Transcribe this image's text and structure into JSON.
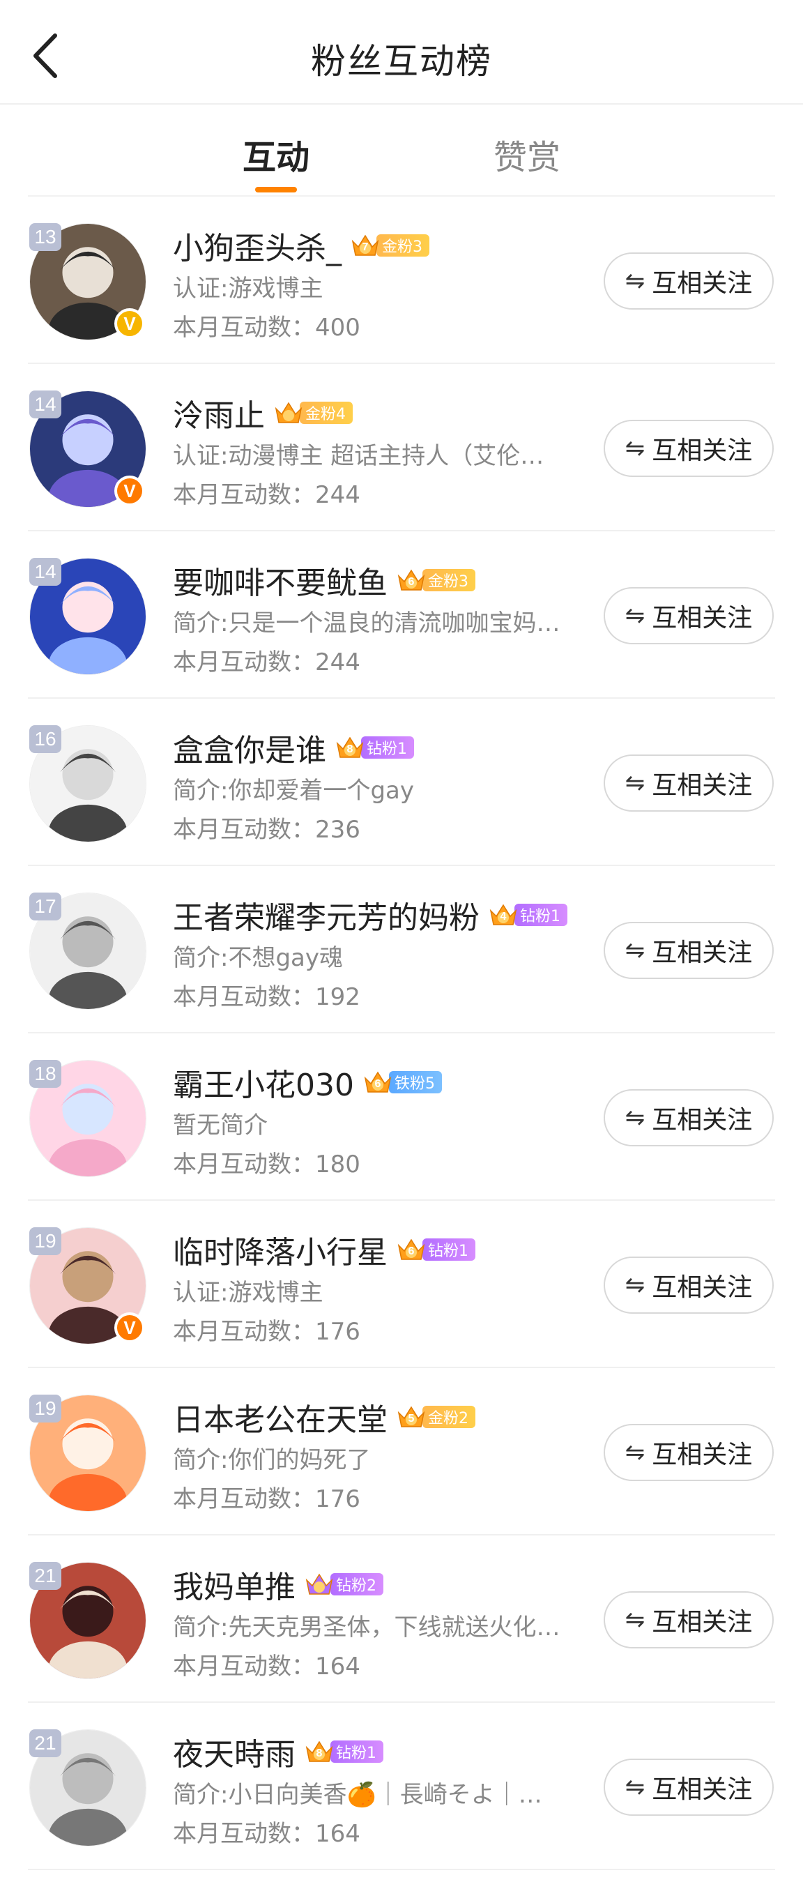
{
  "header": {
    "title": "粉丝互动榜"
  },
  "tabs": [
    {
      "label": "互动",
      "active": true
    },
    {
      "label": "赞赏",
      "active": false
    }
  ],
  "accent_color": "#ff8200",
  "follow_button": {
    "label": "互相关注",
    "icon": "mutual-follow-icon"
  },
  "fans": [
    {
      "rank": "13",
      "name": "小狗歪头杀_",
      "crown_level": "7",
      "badge": "金粉3",
      "badge_type": "gold",
      "desc": "认证:游戏博主",
      "count": "本月互动数：400",
      "verified": "gold"
    },
    {
      "rank": "14",
      "name": "泠雨止",
      "crown_level": "",
      "badge": "金粉4",
      "badge_type": "gold",
      "desc": "认证:动漫博主 超话主持人（艾伦…",
      "count": "本月互动数：244",
      "verified": "orange"
    },
    {
      "rank": "14",
      "name": "要咖啡不要鱿鱼",
      "crown_level": "6",
      "badge": "金粉3",
      "badge_type": "gold",
      "desc": "简介:只是一个温良的清流咖咖宝妈…",
      "count": "本月互动数：244",
      "verified": ""
    },
    {
      "rank": "16",
      "name": "盒盒你是谁",
      "crown_level": "8",
      "badge": "钻粉1",
      "badge_type": "diamond",
      "desc": "简介:你却爱着一个gay",
      "count": "本月互动数：236",
      "verified": ""
    },
    {
      "rank": "17",
      "name": "王者荣耀李元芳的妈粉",
      "crown_level": "4",
      "badge": "钻粉1",
      "badge_type": "diamond",
      "desc": "简介:不想gay魂",
      "count": "本月互动数：192",
      "verified": ""
    },
    {
      "rank": "18",
      "name": "霸王小花030",
      "crown_level": "6",
      "badge": "铁粉5",
      "badge_type": "iron",
      "desc": "暂无简介",
      "count": "本月互动数：180",
      "verified": ""
    },
    {
      "rank": "19",
      "name": "临时降落小行星",
      "crown_level": "6",
      "badge": "钻粉1",
      "badge_type": "diamond",
      "desc": "认证:游戏博主",
      "count": "本月互动数：176",
      "verified": "orange"
    },
    {
      "rank": "19",
      "name": "日本老公在天堂",
      "crown_level": "5",
      "badge": "金粉2",
      "badge_type": "gold",
      "desc": "简介:你们的妈死了",
      "count": "本月互动数：176",
      "verified": ""
    },
    {
      "rank": "21",
      "name": "我妈单推",
      "crown_level": "",
      "badge": "钻粉2",
      "badge_type": "diamond",
      "desc": "简介:先天克男圣体，下线就送火化…",
      "count": "本月互动数：164",
      "verified": ""
    },
    {
      "rank": "21",
      "name": "夜天時雨",
      "crown_level": "8",
      "badge": "钻粉1",
      "badge_type": "diamond",
      "desc": "简介:小日向美香🍊｜長崎そよ｜…",
      "count": "本月互动数：164",
      "verified": ""
    }
  ]
}
